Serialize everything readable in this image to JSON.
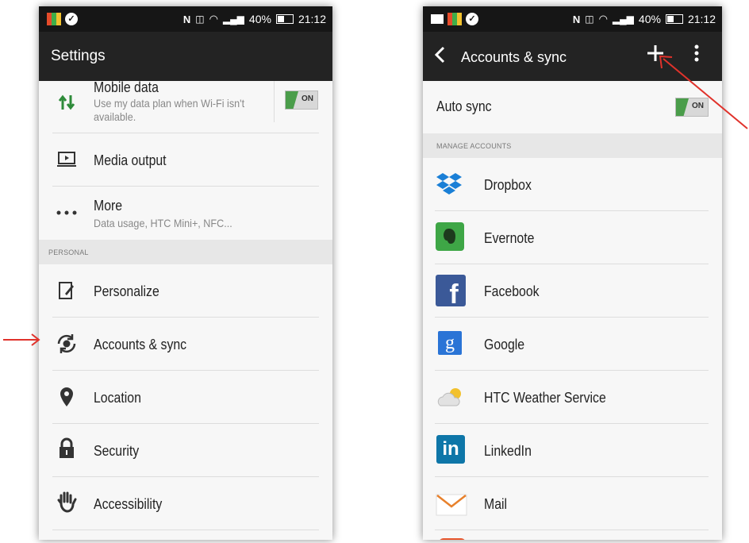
{
  "left_screen": {
    "status": {
      "battery": "40%",
      "time": "21:12"
    },
    "title": "Settings",
    "mobile_data": {
      "label": "Mobile data",
      "sub": "Use my data plan when Wi-Fi isn't available.",
      "toggle": "ON"
    },
    "items": [
      {
        "label": "Media output",
        "icon": "media-output-icon"
      },
      {
        "label": "More",
        "sub": "Data usage, HTC Mini+, NFC...",
        "icon": "more-dots-icon"
      }
    ],
    "section": "PERSONAL",
    "personal_items": [
      {
        "label": "Personalize",
        "icon": "personalize-icon"
      },
      {
        "label": "Accounts & sync",
        "icon": "sync-icon"
      },
      {
        "label": "Location",
        "icon": "location-pin-icon"
      },
      {
        "label": "Security",
        "icon": "lock-icon"
      },
      {
        "label": "Accessibility",
        "icon": "hand-icon"
      }
    ]
  },
  "right_screen": {
    "status": {
      "battery": "40%",
      "time": "21:12"
    },
    "title": "Accounts & sync",
    "auto_sync": {
      "label": "Auto sync",
      "toggle": "ON"
    },
    "section": "MANAGE ACCOUNTS",
    "accounts": [
      {
        "label": "Dropbox",
        "icon": "dropbox-icon"
      },
      {
        "label": "Evernote",
        "icon": "evernote-icon"
      },
      {
        "label": "Facebook",
        "icon": "facebook-icon"
      },
      {
        "label": "Google",
        "icon": "google-icon"
      },
      {
        "label": "HTC Weather Service",
        "icon": "weather-icon"
      },
      {
        "label": "LinkedIn",
        "icon": "linkedin-icon"
      },
      {
        "label": "Mail",
        "icon": "mail-icon"
      }
    ]
  },
  "colors": {
    "annotation_arrow": "#e0322b",
    "toggle_on": "#4a9d4a",
    "appbar": "#232323"
  }
}
